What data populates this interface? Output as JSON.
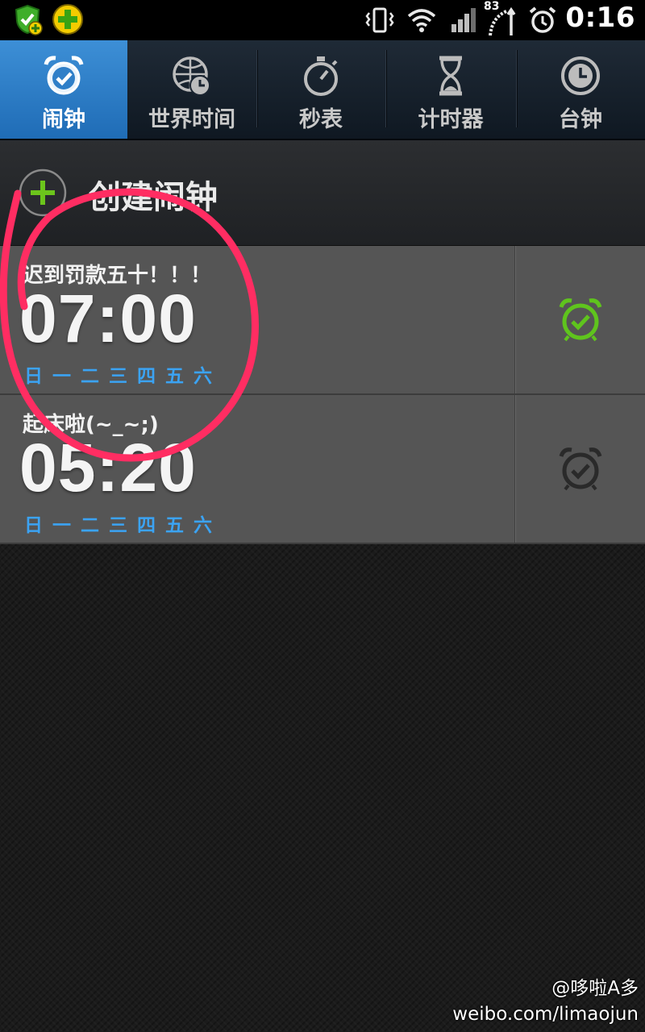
{
  "status_bar": {
    "time": "0:16",
    "battery_level": "83",
    "icons": [
      "security-app-icon",
      "add-app-icon",
      "vibrate-icon",
      "wifi-icon",
      "signal-icon",
      "battery-icon",
      "alarm-icon"
    ]
  },
  "tabs": [
    {
      "label": "闹钟",
      "icon": "alarm-clock-icon",
      "active": true
    },
    {
      "label": "世界时间",
      "icon": "world-clock-icon",
      "active": false
    },
    {
      "label": "秒表",
      "icon": "stopwatch-icon",
      "active": false
    },
    {
      "label": "计时器",
      "icon": "hourglass-icon",
      "active": false
    },
    {
      "label": "台钟",
      "icon": "desk-clock-icon",
      "active": false
    }
  ],
  "create_alarm": {
    "label": "创建闹钟",
    "icon": "add-icon"
  },
  "alarms": [
    {
      "label": "迟到罚款五十！！！",
      "time": "07:00",
      "days": [
        "日",
        "一",
        "二",
        "三",
        "四",
        "五",
        "六"
      ],
      "enabled": true,
      "icon_color": "#5fc41d"
    },
    {
      "label": "起床啦(~_~;)",
      "time": "05:20",
      "days": [
        "日",
        "一",
        "二",
        "三",
        "四",
        "五",
        "六"
      ],
      "enabled": false,
      "icon_color": "#2a2a2a"
    }
  ],
  "colors": {
    "active_tab": "#2f7fc8",
    "day_text": "#3ba3f3",
    "annotation_circle": "#ff2d62"
  },
  "watermark": {
    "line1": "@哆啦A多",
    "line2": "weibo.com/limaojun"
  }
}
